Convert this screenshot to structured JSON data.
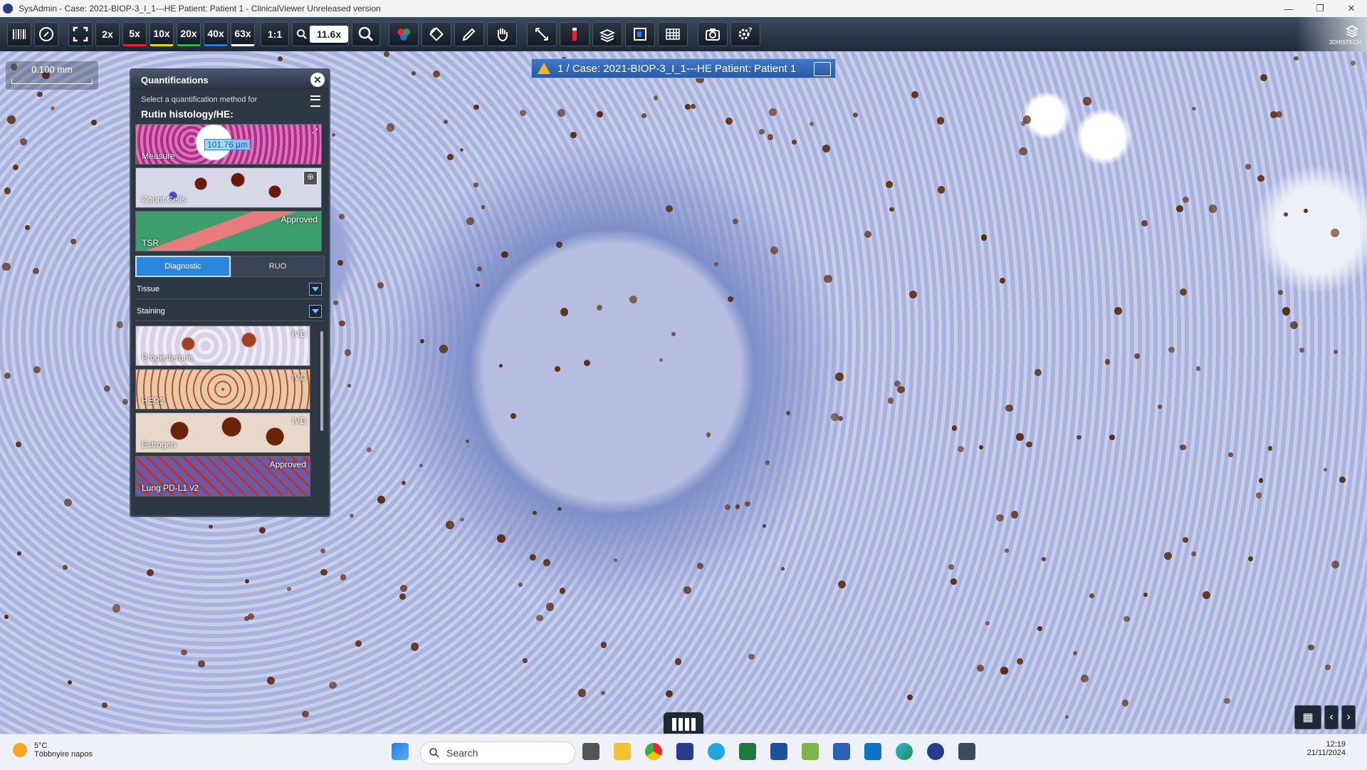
{
  "window": {
    "title": "SysAdmin - Case: 2021-BIOP-3_I_1---HE Patient: Patient 1 - ClinicalViewer Unreleased version"
  },
  "toolbar": {
    "zoom_buttons": [
      "2x",
      "5x",
      "10x",
      "20x",
      "40x",
      "63x"
    ],
    "one_to_one": "1:1",
    "zoom_value": "11.6x",
    "brand": "3DHISTECH"
  },
  "scale": {
    "label": "0.100 mm"
  },
  "case": {
    "banner": "1 / Case: 2021-BIOP-3_I_1---HE Patient: Patient 1"
  },
  "panel": {
    "title": "Quantifications",
    "subtitle": "Select a quantification method for",
    "section": "Rutin histology/HE:",
    "methods": [
      {
        "label": "Measure",
        "badge": "",
        "measure": "101.76 µm"
      },
      {
        "label": "Count Cells",
        "badge": ""
      },
      {
        "label": "TSR",
        "badge": "Approved"
      }
    ],
    "tabs": [
      "Diagnostic",
      "RUO"
    ],
    "dropdowns": [
      "Tissue",
      "Staining"
    ],
    "stains": [
      {
        "label": "Progesterone",
        "badge": "IVD"
      },
      {
        "label": "HER2",
        "badge": "IVD"
      },
      {
        "label": "Estrogen",
        "badge": "IVD"
      },
      {
        "label": "Lung PD-L1 v2",
        "badge": "Approved"
      }
    ]
  },
  "taskbar": {
    "weather_temp": "5°C",
    "weather_desc": "Többnyire napos",
    "search_placeholder": "Search",
    "time": "12:19",
    "date": "21/11/2024"
  }
}
